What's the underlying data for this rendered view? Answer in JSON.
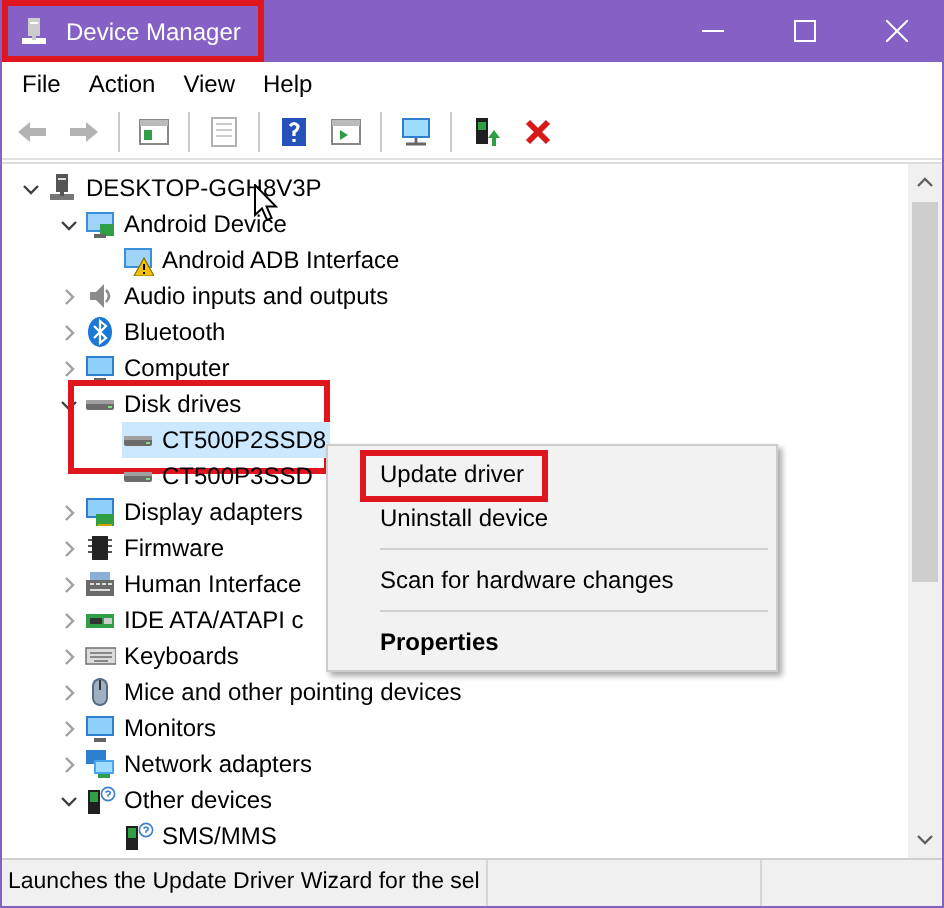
{
  "window": {
    "title": "Device Manager",
    "highlighted": true
  },
  "menu": [
    {
      "label": "File"
    },
    {
      "label": "Action"
    },
    {
      "label": "View"
    },
    {
      "label": "Help"
    }
  ],
  "toolbar": [
    {
      "kind": "back",
      "disabled": true
    },
    {
      "kind": "forward",
      "disabled": true
    },
    {
      "kind": "sep"
    },
    {
      "kind": "tree-pane",
      "disabled": false
    },
    {
      "kind": "sep"
    },
    {
      "kind": "properties",
      "disabled": true
    },
    {
      "kind": "sep"
    },
    {
      "kind": "help",
      "disabled": false
    },
    {
      "kind": "action-pane",
      "disabled": false
    },
    {
      "kind": "sep"
    },
    {
      "kind": "scan",
      "disabled": false
    },
    {
      "kind": "sep"
    },
    {
      "kind": "update",
      "disabled": false
    },
    {
      "kind": "uninstall",
      "disabled": false
    }
  ],
  "tree": {
    "label": "DESKTOP-GGH8V3P",
    "kind": "computer",
    "expanded": true,
    "selected": false,
    "children": [
      {
        "label": "Android Device",
        "kind": "android",
        "expanded": true,
        "selected": false,
        "children": [
          {
            "label": "Android ADB Interface",
            "kind": "warning-device",
            "selected": false
          }
        ]
      },
      {
        "label": "Audio inputs and outputs",
        "kind": "audio",
        "expanded": false,
        "selected": false
      },
      {
        "label": "Bluetooth",
        "kind": "bluetooth",
        "expanded": false,
        "selected": false
      },
      {
        "label": "Computer",
        "kind": "monitor",
        "expanded": false,
        "selected": false
      },
      {
        "label": "Disk drives",
        "kind": "disk",
        "expanded": true,
        "selected": false,
        "highlighted": true,
        "children": [
          {
            "label": "CT500P2SSD8",
            "kind": "disk",
            "selected": true
          },
          {
            "label": "CT500P3SSD",
            "kind": "disk",
            "selected": false
          }
        ]
      },
      {
        "label": "Display adapters",
        "kind": "display",
        "expanded": false,
        "selected": false
      },
      {
        "label": "Firmware",
        "kind": "chip",
        "expanded": false,
        "selected": false
      },
      {
        "label": "Human Interface",
        "kind": "hid",
        "expanded": false,
        "selected": false
      },
      {
        "label": "IDE ATA/ATAPI c",
        "kind": "ide",
        "expanded": false,
        "selected": false
      },
      {
        "label": "Keyboards",
        "kind": "keyboard",
        "expanded": false,
        "selected": false
      },
      {
        "label": "Mice and other pointing devices",
        "kind": "mouse",
        "expanded": false,
        "selected": false
      },
      {
        "label": "Monitors",
        "kind": "monitor",
        "expanded": false,
        "selected": false
      },
      {
        "label": "Network adapters",
        "kind": "network",
        "expanded": false,
        "selected": false
      },
      {
        "label": "Other devices",
        "kind": "unknown",
        "expanded": true,
        "selected": false,
        "children": [
          {
            "label": "SMS/MMS",
            "kind": "unknown",
            "selected": false
          }
        ]
      }
    ]
  },
  "context_menu": [
    {
      "kind": "item",
      "label": "Update driver",
      "bold": false,
      "highlighted": true
    },
    {
      "kind": "item",
      "label": "Uninstall device",
      "bold": false,
      "highlighted": false
    },
    {
      "kind": "separator"
    },
    {
      "kind": "item",
      "label": "Scan for hardware changes",
      "bold": false,
      "highlighted": false
    },
    {
      "kind": "separator"
    },
    {
      "kind": "item",
      "label": "Properties",
      "bold": true,
      "highlighted": false
    }
  ],
  "status_bar": "Launches the Update Driver Wizard for the sel"
}
